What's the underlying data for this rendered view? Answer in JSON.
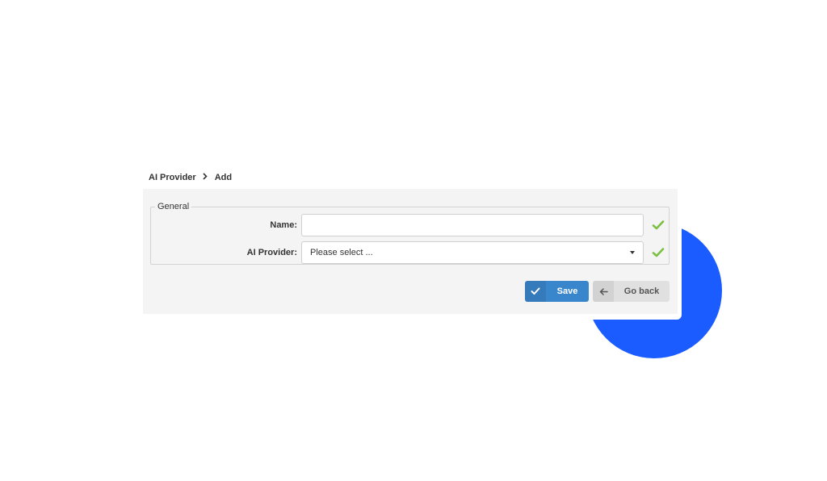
{
  "colors": {
    "accent_circle": "#1a5cff",
    "save_button": "#3a86cd",
    "back_button": "#e0e0e0",
    "valid_check": "#7bc043"
  },
  "breadcrumb": {
    "items": [
      "AI Provider",
      "Add"
    ],
    "separator_icon": "chevron-right-icon"
  },
  "form": {
    "section_title": "General",
    "fields": {
      "name": {
        "label": "Name:",
        "value": "",
        "placeholder": "",
        "status_icon": "check-icon"
      },
      "ai_provider": {
        "label": "AI Provider:",
        "selected": "Please select ...",
        "status_icon": "check-icon"
      }
    }
  },
  "actions": {
    "save": {
      "label": "Save",
      "icon": "check-icon"
    },
    "back": {
      "label": "Go back",
      "icon": "arrow-left-icon"
    }
  }
}
